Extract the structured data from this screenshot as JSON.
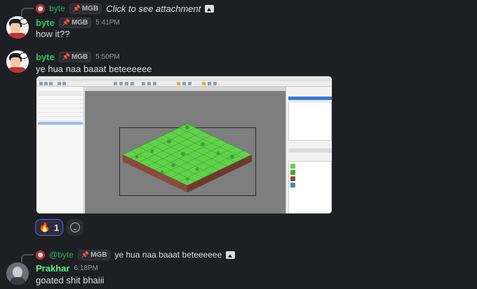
{
  "messages": [
    {
      "reply": {
        "author": "byte",
        "tag": "MGB",
        "text": "Click to see attachment"
      },
      "author": "byte",
      "tag": "MGB",
      "time": "5:41PM",
      "text": "how it??"
    },
    {
      "author": "byte",
      "tag": "MGB",
      "time": "5:50PM",
      "text": "ye hua naa baaat beteeeeee",
      "attachment": {
        "type": "image",
        "icon": "tile-map-editor-screenshot"
      },
      "reactions": [
        {
          "emoji": "fire-emoji",
          "count": "1"
        }
      ]
    },
    {
      "reply": {
        "author": "@byte",
        "tag": "MGB",
        "text": "ye hua naa baaat beteeeeee"
      },
      "author": "Prakhar",
      "time": "6:18PM",
      "text": "goated shit bhaiii"
    }
  ],
  "colors": {
    "background": "#1e1f22",
    "byte_name": "#2dc770",
    "prakhar_name": "#57f287",
    "reaction_border": "#5865f2",
    "grass": "#5fd34a",
    "dirt": "#8a4a3c"
  }
}
